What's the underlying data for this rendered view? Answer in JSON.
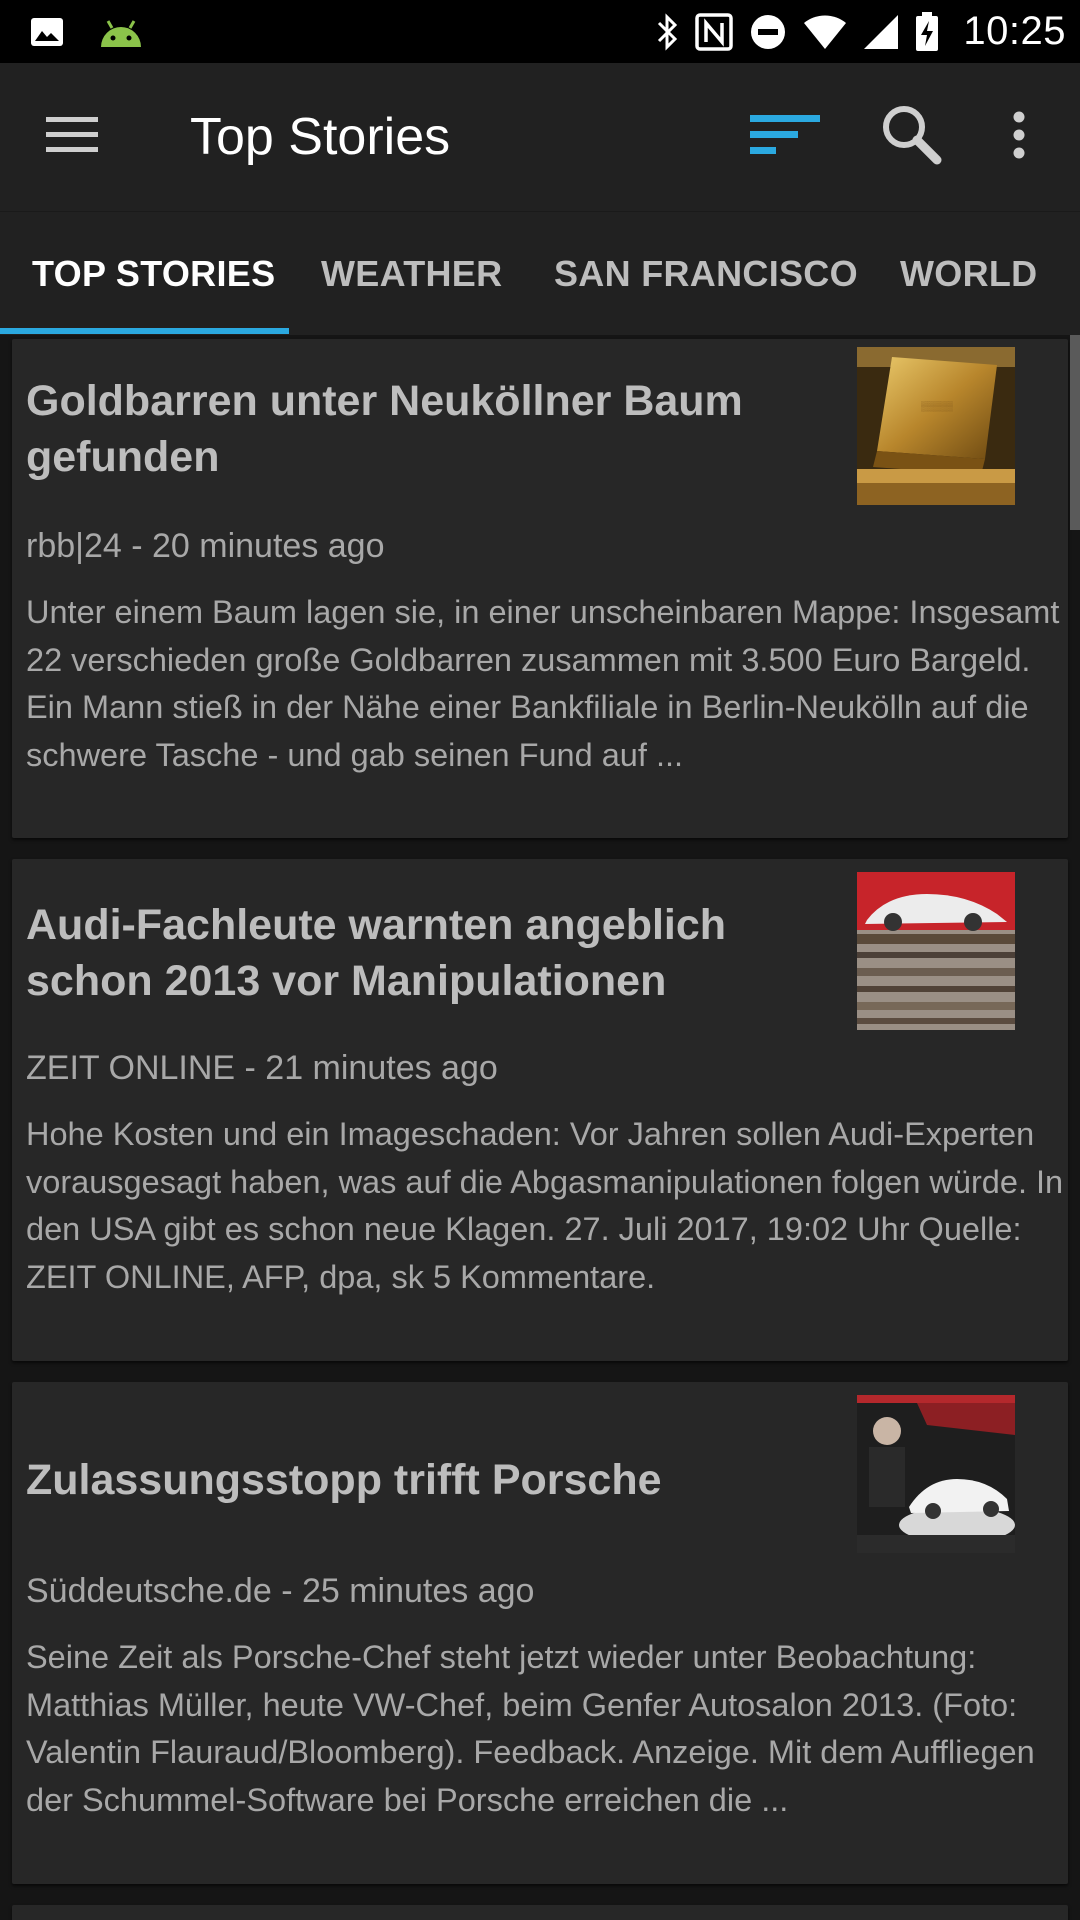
{
  "status_bar": {
    "time": "10:25",
    "icons": [
      "image-icon",
      "android-icon",
      "bluetooth-icon",
      "nfc-icon",
      "do-not-disturb-icon",
      "wifi-icon",
      "signal-icon",
      "battery-icon"
    ]
  },
  "app_bar": {
    "title": "Top Stories",
    "accent_color": "#2ba9e0"
  },
  "tabs": [
    {
      "label": "TOP STORIES",
      "active": true
    },
    {
      "label": "WEATHER",
      "active": false
    },
    {
      "label": "SAN FRANCISCO",
      "active": false
    },
    {
      "label": "WORLD",
      "active": false
    }
  ],
  "stories": [
    {
      "title": "Goldbarren unter Neuköllner Baum gefunden",
      "source": "rbb|24 - 20 minutes ago",
      "snippet": "Unter einem Baum lagen sie, in einer unscheinbaren Mappe: Insgesamt 22 verschieden große Goldbarren zusammen mit 3.500 Euro Bargeld. Ein Mann stieß in der Nähe einer Bankfiliale in Berlin-Neukölln auf die schwere Tasche - und gab seinen Fund auf ...",
      "thumbnail": "gold-bars-image"
    },
    {
      "title": "Audi-Fachleute warnten angeblich schon 2013 vor Manipulationen",
      "source": "ZEIT ONLINE - 21 minutes ago",
      "snippet": "Hohe Kosten und ein Imageschaden: Vor Jahren sollen Audi-Experten vorausgesagt haben, was auf die Abgasmanipulationen folgen würde. In den USA gibt es schon neue Klagen. 27. Juli 2017, 19:02 Uhr Quelle: ZEIT ONLINE, AFP, dpa, sk 5 Kommentare.",
      "thumbnail": "audi-car-image"
    },
    {
      "title": "Zulassungsstopp trifft Porsche",
      "source": "Süddeutsche.de - 25 minutes ago",
      "snippet": "Seine Zeit als Porsche-Chef steht jetzt wieder unter Beobachtung: Matthias Müller, heute VW-Chef, beim Genfer Autosalon 2013. (Foto: Valentin Flauraud/Bloomberg). Feedback. Anzeige. Mit dem Auffliegen der Schummel-Software bei Porsche erreichen die ...",
      "thumbnail": "porsche-image"
    }
  ]
}
